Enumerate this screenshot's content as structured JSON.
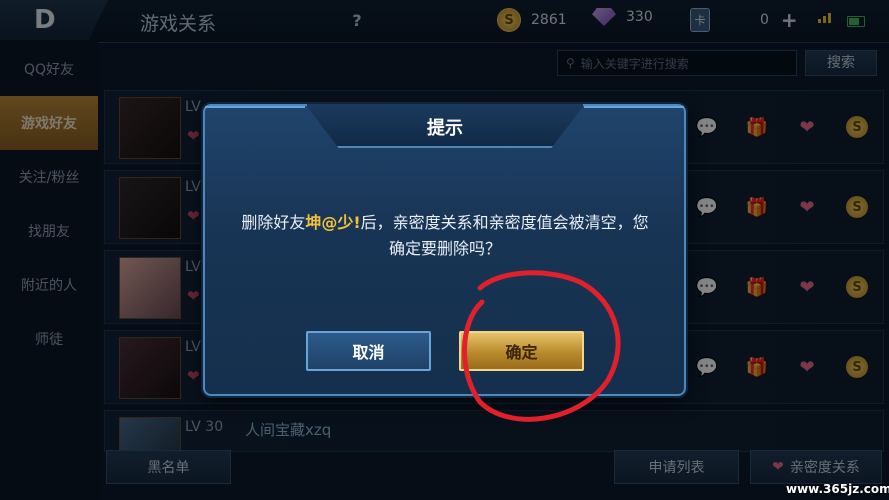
{
  "header": {
    "back_glyph": "D",
    "title": "游戏关系",
    "help": "?",
    "resources": {
      "gold": "2861",
      "gold_icon": "S",
      "diamonds": "330",
      "tickets": "0",
      "ticket_icon": "卡",
      "plus": "+"
    }
  },
  "sidebar": {
    "items": [
      {
        "label": "QQ好友"
      },
      {
        "label": "游戏好友"
      },
      {
        "label": "关注/粉丝"
      },
      {
        "label": "找朋友"
      },
      {
        "label": "附近的人"
      },
      {
        "label": "师徒"
      }
    ],
    "active_index": 1
  },
  "search": {
    "placeholder": "输入关键字进行搜索",
    "button": "搜索"
  },
  "friends": [
    {
      "level": "LV",
      "name": ""
    },
    {
      "level": "LV",
      "name": ""
    },
    {
      "level": "LV",
      "name": ""
    },
    {
      "level": "LV",
      "name": ""
    },
    {
      "level": "LV 30",
      "name": "人间宝藏xzq"
    }
  ],
  "bottom": {
    "blacklist": "黑名单",
    "apply_list": "申请列表",
    "intimacy": "亲密度关系"
  },
  "dialog": {
    "title": "提示",
    "message_prefix": "删除好友",
    "friend_name": "坤@少!",
    "message_suffix": "后，亲密度关系和亲密度值会被清空，您确定要删除吗？",
    "cancel": "取消",
    "confirm": "确定"
  },
  "watermark": "www.365jz.com",
  "colors": {
    "accent_gold": "#f3c23c",
    "annotation_red": "#e0202a",
    "dialog_border": "#4f88bd"
  }
}
